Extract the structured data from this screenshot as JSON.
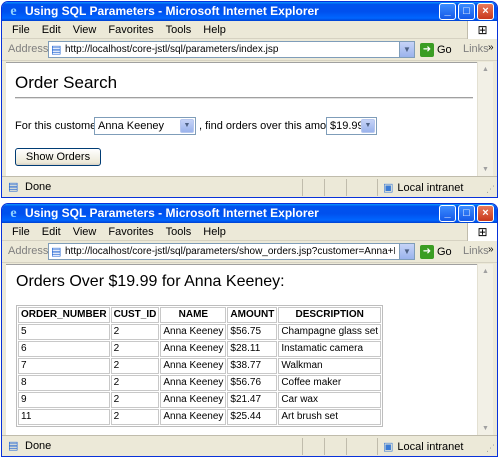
{
  "window1": {
    "title": "Using SQL Parameters - Microsoft Internet Explorer",
    "menu": [
      "File",
      "Edit",
      "View",
      "Favorites",
      "Tools",
      "Help"
    ],
    "address_label": "Address",
    "url": "http://localhost/core-jstl/sql/parameters/index.jsp",
    "go_label": "Go",
    "links_label": "Links",
    "status": "Done",
    "zone": "Local intranet",
    "page": {
      "heading": "Order Search",
      "customer_label": "For this customer:",
      "customer_value": "Anna Keeney",
      "amount_label": ", find orders over this amount:",
      "amount_value": "$19.99",
      "button_label": "Show Orders"
    }
  },
  "window2": {
    "title": "Using SQL Parameters - Microsoft Internet Explorer",
    "menu": [
      "File",
      "Edit",
      "View",
      "Favorites",
      "Tools",
      "Help"
    ],
    "address_label": "Address",
    "url": "http://localhost/core-jstl/sql/parameters/show_orders.jsp?customer=Anna+Keeney&amount=",
    "go_label": "Go",
    "links_label": "Links",
    "status": "Done",
    "zone": "Local intranet",
    "page": {
      "heading": "Orders Over $19.99 for Anna Keeney:",
      "columns": [
        "ORDER_NUMBER",
        "CUST_ID",
        "NAME",
        "AMOUNT",
        "DESCRIPTION"
      ],
      "rows": [
        [
          "5",
          "2",
          "Anna Keeney",
          "$56.75",
          "Champagne glass set"
        ],
        [
          "6",
          "2",
          "Anna Keeney",
          "$28.11",
          "Instamatic camera"
        ],
        [
          "7",
          "2",
          "Anna Keeney",
          "$38.77",
          "Walkman"
        ],
        [
          "8",
          "2",
          "Anna Keeney",
          "$56.76",
          "Coffee maker"
        ],
        [
          "9",
          "2",
          "Anna Keeney",
          "$21.47",
          "Car wax"
        ],
        [
          "11",
          "2",
          "Anna Keeney",
          "$25.44",
          "Art brush set"
        ]
      ]
    }
  }
}
